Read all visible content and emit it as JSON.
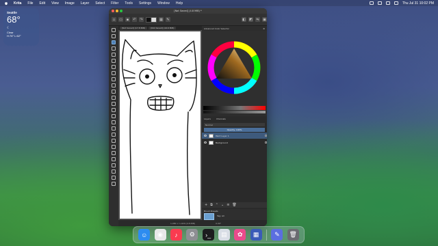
{
  "menubar": {
    "app_name": "Krita",
    "items": [
      "File",
      "Edit",
      "View",
      "Image",
      "Layer",
      "Select",
      "Filter",
      "Tools",
      "Settings",
      "Window",
      "Help"
    ],
    "clock": "Thu Jul 31  10:02 PM"
  },
  "weather": {
    "city": "Seattle",
    "temperature": "68°",
    "condition": "Clear",
    "range": "H:76° L:62°"
  },
  "krita": {
    "window_title": "[Not Saved]  (4.8 MiB) *",
    "tabs": [
      "[Not Saved] (17.8 MiB)",
      "[Not Saved] (16.6 MiB)"
    ],
    "docker_title": "Advanced Color Selector",
    "layers_tabs": [
      "Layers",
      "Channels"
    ],
    "blend_mode": "Normal",
    "opacity": "Opacity: 100%",
    "layers": [
      {
        "name": "Paint Layer 1",
        "selected": true
      },
      {
        "name": "Background",
        "selected": false
      }
    ],
    "brush_presets_title": "Brush Presets",
    "brush_tag": "Tag: All",
    "status_zoom": "1,080 × 1,920 (4.8 MiB)",
    "status_rotation": "0.00°"
  },
  "dock": {
    "apps": [
      {
        "icon": "finder-icon",
        "color": "#2d8cf0"
      },
      {
        "icon": "chrome-icon",
        "color": "#e8e8e8"
      },
      {
        "icon": "music-icon",
        "color": "#fa3b50"
      },
      {
        "icon": "settings-icon",
        "color": "#8e8e93"
      },
      {
        "icon": "terminal-icon",
        "color": "#1c1c1e"
      },
      {
        "icon": "preview-icon",
        "color": "#d9dee6"
      },
      {
        "icon": "krita-icon",
        "color": "#e94b8c"
      },
      {
        "icon": "calculator-icon",
        "color": "#3a5bb8"
      },
      {
        "icon": "pages-icon",
        "color": "#5b6ee0"
      },
      {
        "icon": "trash-icon",
        "color": "#6b6b70"
      }
    ]
  }
}
